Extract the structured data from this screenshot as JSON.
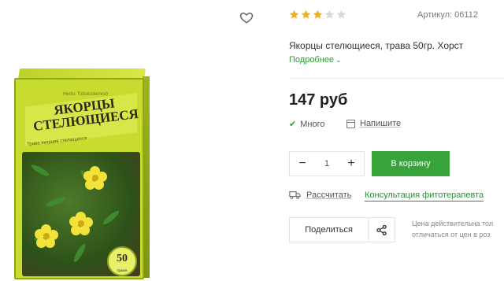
{
  "product": {
    "title": "Якорцы стелющиеся, трава 50гр. Хорст",
    "article": "Артикул: 06112",
    "rating": {
      "value": 3,
      "max": 5
    },
    "more_link": "Подробнее",
    "price": "147 руб",
    "stock": "Много",
    "write_link": "Напишите",
    "quantity": "1",
    "cart_button": "В корзину",
    "calc_link": "Рассчитать",
    "consult_link": "Консультация фитотерапевта",
    "share_button": "Поделиться",
    "note_line1": "Цена действительна тол",
    "note_line2": "отличаться от цен в роз"
  },
  "package": {
    "brand_line": "Herbs Tribulusterrestr",
    "title_line1": "ЯКОРЦЫ",
    "title_line2": "СТЕЛЮЩИЕСЯ",
    "subtitle": "Трава якорцев стелющихся",
    "weight": "50",
    "weight_unit": "грамм"
  },
  "colors": {
    "accent": "#37a33a",
    "link": "#2e9b3a",
    "star_on": "#f2b01e",
    "star_off": "#d9d9d9"
  },
  "icons": {
    "favorite": "heart-icon",
    "stock": "check-icon",
    "write": "calendar-icon",
    "calc": "truck-icon",
    "share": "share-icon",
    "more": "chevron-down-icon"
  }
}
